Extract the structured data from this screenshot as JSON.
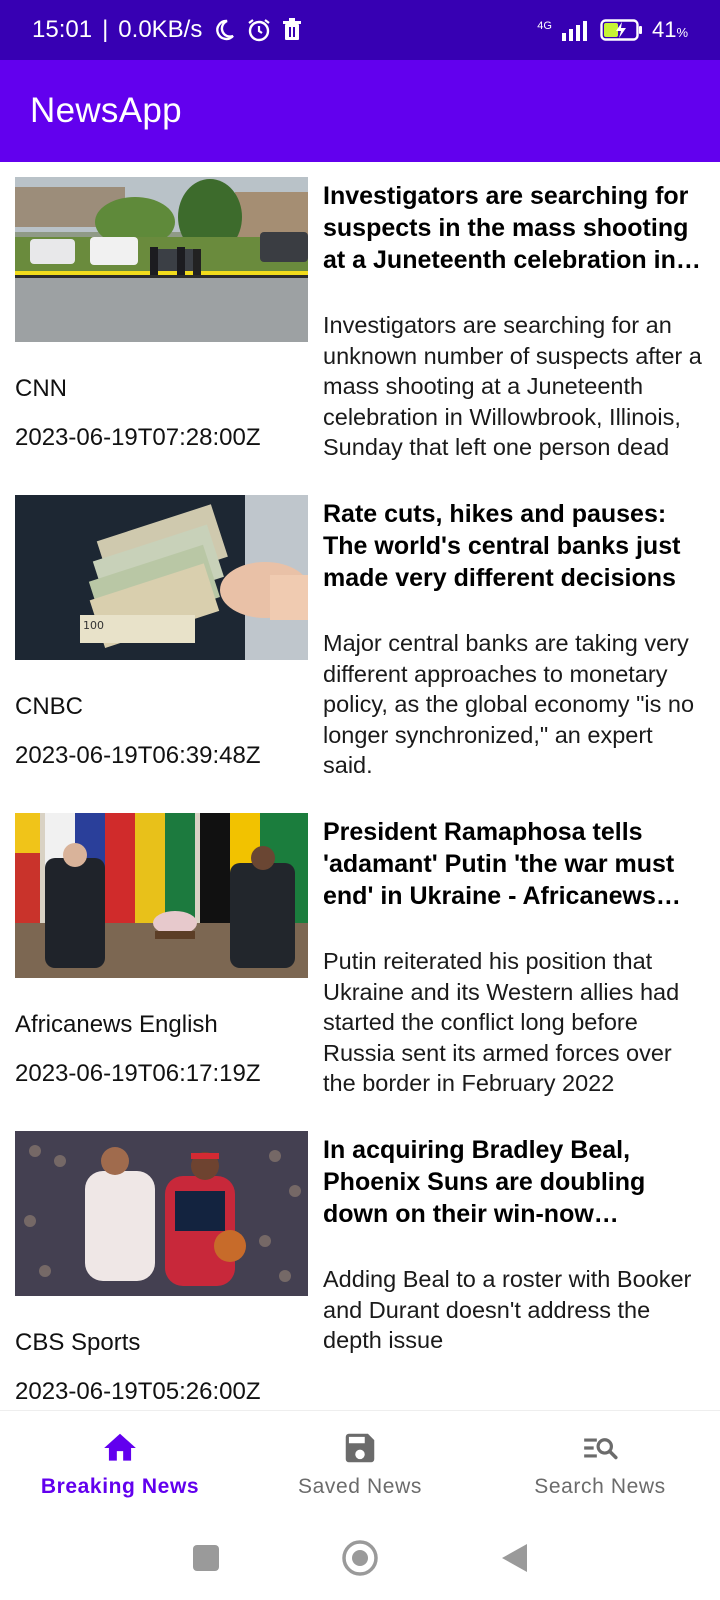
{
  "status_bar": {
    "time": "15:01",
    "speed": "0.0KB/s",
    "network": "4G",
    "battery": "41",
    "battery_unit": "%",
    "icons": [
      "moon-icon",
      "alarm-icon",
      "trash-icon",
      "signal-icon",
      "battery-charging-icon"
    ]
  },
  "app_bar": {
    "title": "NewsApp"
  },
  "articles": [
    {
      "title": "Investigators are searching for suspects in the mass shooting at a Juneteenth celebration in Willowbrook, Illinois",
      "description": "Investigators are searching for an unknown number of suspects after a mass shooting at a Juneteenth celebration in Willowbrook, Illinois, Sunday that left one person dead",
      "source": "CNN",
      "published_at": "2023-06-19T07:28:00Z"
    },
    {
      "title": "Rate cuts, hikes and pauses: The world's central banks just made very different decisions",
      "description": "Major central banks are taking very different approaches to monetary policy, as the global economy \"is no longer synchronized,\" an expert said.",
      "source": "CNBC",
      "published_at": "2023-06-19T06:39:48Z"
    },
    {
      "title": "President Ramaphosa tells 'adamant' Putin 'the war must end' in Ukraine - Africanews English",
      "description": "Putin reiterated his position that Ukraine and its Western allies had started the conflict long before Russia sent its armed forces over the border in February 2022",
      "source": "Africanews English",
      "published_at": "2023-06-19T06:17:19Z"
    },
    {
      "title": "In acquiring Bradley Beal, Phoenix Suns are doubling down on their win-now mentality",
      "description": "Adding Beal to a roster with Booker and Durant doesn't address the depth issue",
      "source": "CBS Sports",
      "published_at": "2023-06-19T05:26:00Z"
    }
  ],
  "bottom_nav": {
    "items": [
      {
        "label": "Breaking News",
        "icon": "home-icon",
        "active": true
      },
      {
        "label": "Saved News",
        "icon": "save-icon",
        "active": false
      },
      {
        "label": "Search News",
        "icon": "search-list-icon",
        "active": false
      }
    ]
  },
  "colors": {
    "status_bar": "#3700b3",
    "primary": "#6200ee",
    "inactive": "#6b6b6b"
  }
}
